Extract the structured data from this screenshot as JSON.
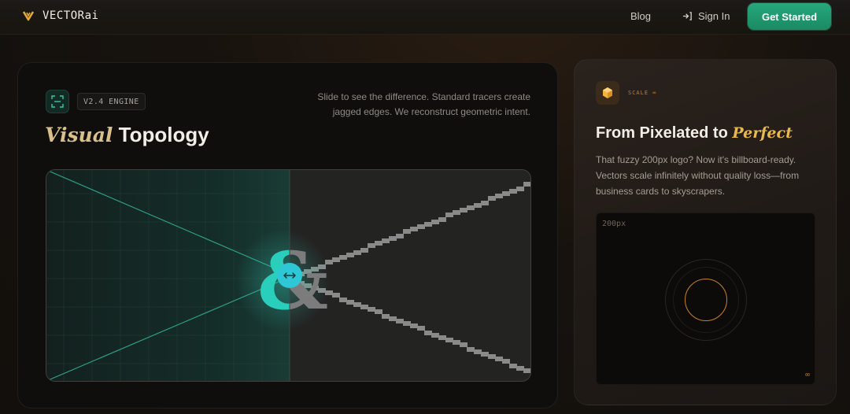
{
  "nav": {
    "brand": "VECTORai",
    "links": {
      "blog": "Blog",
      "sign_in": "Sign In"
    },
    "cta": "Get Started"
  },
  "topology": {
    "badge": "V2.4 ENGINE",
    "title_accent": "Visual",
    "title_rest": " Topology",
    "description": "Slide to see the difference. Standard tracers create jagged edges. We reconstruct geometric intent.",
    "glyph": "&",
    "icons": {
      "engine": "scan-icon",
      "handle": "resize-horizontal-icon"
    },
    "colors": {
      "vector": "#2ad4bc",
      "raster": "#7b7b7b",
      "accent": "#d9c08a"
    },
    "slider_position": 0.5
  },
  "scale": {
    "label": "SCALE ∞",
    "title_start": "From Pixelated to ",
    "title_accent": "Perfect",
    "description": "That fuzzy 200px logo? Now it's billboard-ready. Vectors scale infinitely without quality loss—from business cards to skyscrapers.",
    "preview_label": "200px",
    "preview_badge": "∞",
    "icons": {
      "scale": "cube-icon"
    },
    "colors": {
      "accent": "#e7b94e",
      "ring": "#c98327"
    }
  },
  "colors": {
    "brand_green": "#1f9a70",
    "background": "#15110d"
  }
}
